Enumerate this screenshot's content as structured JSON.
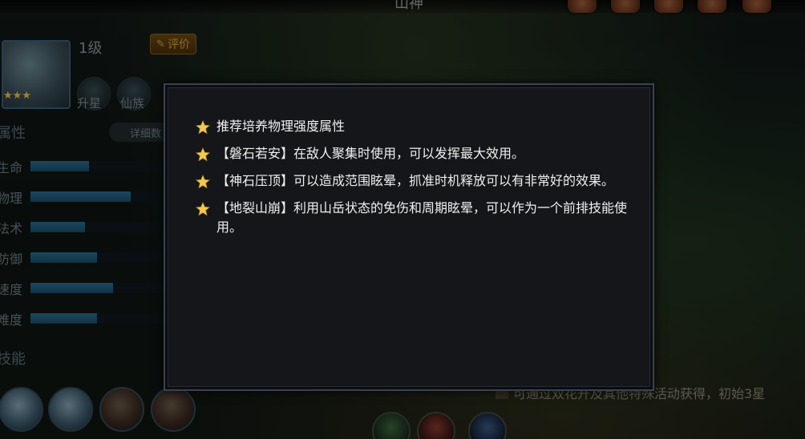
{
  "header": {
    "title": "山神"
  },
  "hero": {
    "level_label": "1级",
    "rate_label": "评价",
    "stars": "★★★",
    "upgrade_label": "升星",
    "tribe_label": "仙族"
  },
  "attributes": {
    "section_label": "属性",
    "detail_label": "详细数",
    "stats": [
      {
        "label": "生命",
        "value": 0.44
      },
      {
        "label": "物理",
        "value": 0.75
      },
      {
        "label": "法术",
        "value": 0.41
      },
      {
        "label": "防御",
        "value": 0.5
      },
      {
        "label": "速度",
        "value": 0.62
      },
      {
        "label": "难度",
        "value": 0.5
      }
    ]
  },
  "skills": {
    "section_label": "技能"
  },
  "bottom_hint": "可通过双花开及其他特殊活动获得，初始3星",
  "modal": {
    "tips": [
      "推荐培养物理强度属性",
      "【磐石若安】在敌人聚集时使用，可以发挥最大效用。",
      "【神石压顶】可以造成范围眩晕，抓准时机释放可以有非常好的效果。",
      "【地裂山崩】利用山岳状态的免伤和周期眩晕，可以作为一个前排技能使用。"
    ]
  },
  "colors": {
    "accent_gold": "#f2c94c",
    "modal_bg": "#14161a",
    "stat_bar": "#2a6f92"
  },
  "icons": {
    "tip_bullet": "star-icon",
    "rate": "edit-icon"
  }
}
